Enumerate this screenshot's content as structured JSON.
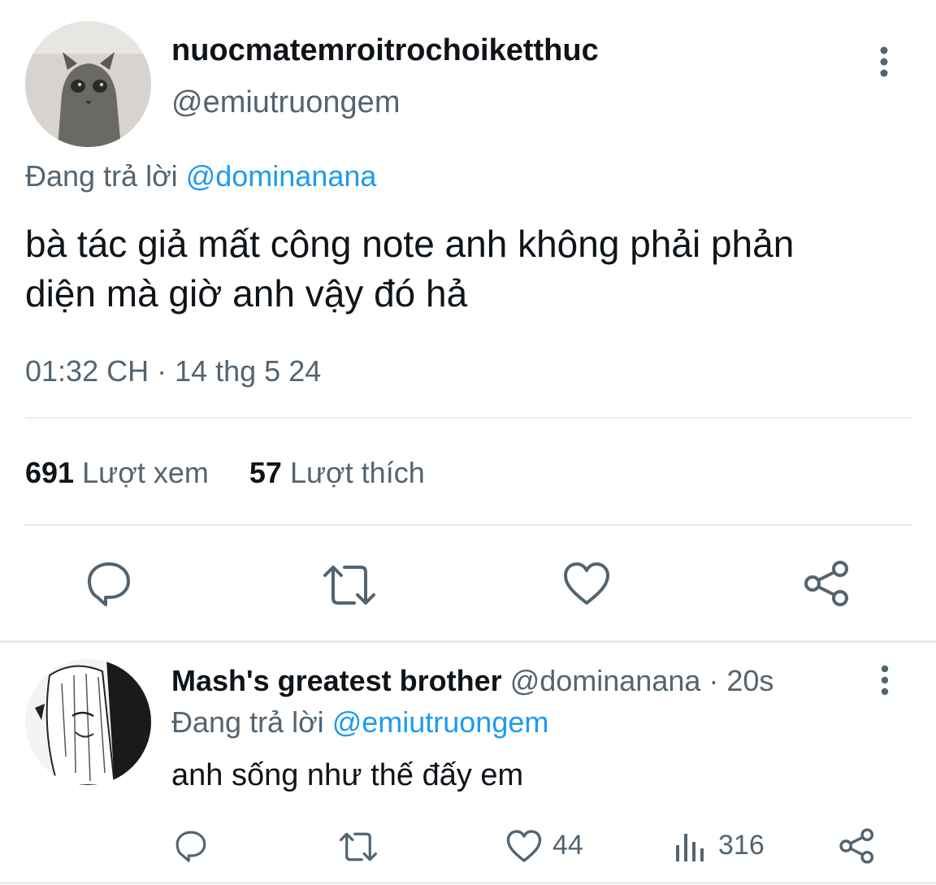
{
  "main_tweet": {
    "display_name": "nuocmatemroitrochoiketthuc",
    "handle": "@emiutruongem",
    "replying_prefix": "Đang trả lời",
    "replying_to": "@dominanana",
    "text_line1": "bà tác giả mất công note anh không phải phản",
    "text_line2": "diện mà giờ anh vậy đó hả",
    "timestamp": "01:32 CH · 14 thg 5 24",
    "views_count": "691",
    "views_label": "Lượt xem",
    "likes_count": "57",
    "likes_label": "Lượt thích"
  },
  "reply_tweet": {
    "display_name": "Mash's greatest brother",
    "handle_time": "@dominanana · 20s",
    "replying_prefix": "Đang trả lời",
    "replying_to": "@emiutruongem",
    "text": "anh sống như thế đấy em",
    "like_count": "44",
    "view_count": "316"
  },
  "colors": {
    "accent": "#1d9bf0",
    "muted": "#536471",
    "divider": "#e6ecf0"
  },
  "icons": [
    "more-icon",
    "reply-icon",
    "retweet-icon",
    "like-icon",
    "share-icon",
    "views-icon"
  ]
}
